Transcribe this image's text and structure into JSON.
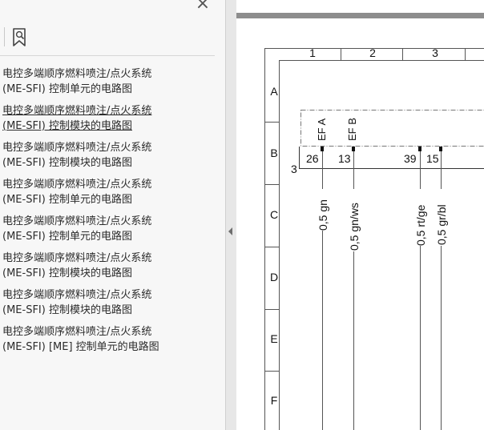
{
  "sidebar": {
    "close_glyph": "×",
    "toolbar": {
      "bookmark_icon": "bookmark-search-icon"
    },
    "items": [
      {
        "line1": "电控多端顺序燃料喷注/点火系统",
        "line2": "(ME-SFI) 控制单元的电路图"
      },
      {
        "line1": "电控多端顺序燃料喷注/点火系统",
        "line2": "(ME-SFI) 控制模块的电路图"
      },
      {
        "line1": "电控多端顺序燃料喷注/点火系统",
        "line2": "(ME-SFI) 控制模块的电路图"
      },
      {
        "line1": "电控多端顺序燃料喷注/点火系统",
        "line2": "(ME-SFI) 控制单元的电路图"
      },
      {
        "line1": "电控多端顺序燃料喷注/点火系统",
        "line2": "(ME-SFI) 控制单元的电路图"
      },
      {
        "line1": "电控多端顺序燃料喷注/点火系统",
        "line2": "(ME-SFI) 控制模块的电路图"
      },
      {
        "line1": "电控多端顺序燃料喷注/点火系统",
        "line2": "(ME-SFI) 控制模块的电路图"
      },
      {
        "line1": "电控多端顺序燃料喷注/点火系统",
        "line2": "(ME-SFI) [ME] 控制单元的电路图"
      }
    ],
    "selected_index": 1,
    "collapse_icon": "triangle-left-icon"
  },
  "diagram": {
    "col_labels": [
      "1",
      "2",
      "3"
    ],
    "row_labels": [
      "A",
      "B",
      "C",
      "D",
      "E",
      "F"
    ],
    "side_number": "3",
    "connector_labels": [
      "EF A",
      "EF B"
    ],
    "pins": [
      "26",
      "13",
      "39",
      "15"
    ],
    "wires": [
      "0,5 gn",
      "0,5 gn/ws",
      "0,5 rt/ge",
      "0,5 gr/bl"
    ]
  }
}
